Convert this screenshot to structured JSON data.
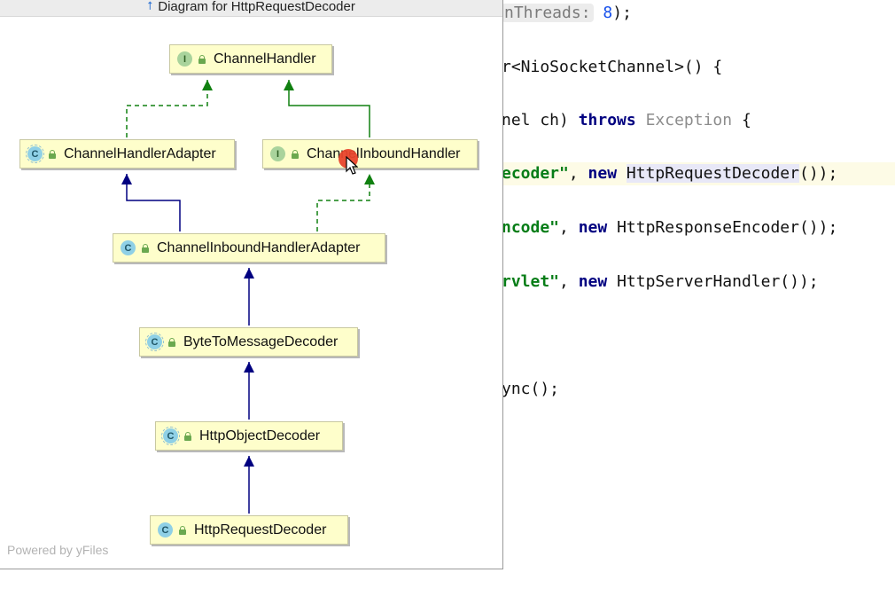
{
  "popup": {
    "title": "Diagram for HttpRequestDecoder",
    "powered_by": "Powered by yFiles"
  },
  "diagram": {
    "nodes": [
      {
        "id": "channel-handler",
        "kind": "I",
        "label": "ChannelHandler"
      },
      {
        "id": "channel-handler-adapter",
        "kind": "C",
        "label": "ChannelHandlerAdapter"
      },
      {
        "id": "channel-inbound-handler",
        "kind": "I",
        "label": "ChannelInboundHandler"
      },
      {
        "id": "channel-inbound-handler-adapter",
        "kind": "C",
        "label": "ChannelInboundHandlerAdapter"
      },
      {
        "id": "byte-to-message-decoder",
        "kind": "C",
        "label": "ByteToMessageDecoder"
      },
      {
        "id": "http-object-decoder",
        "kind": "C",
        "label": "HttpObjectDecoder"
      },
      {
        "id": "http-request-decoder",
        "kind": "C",
        "label": "HttpRequestDecoder"
      }
    ],
    "edges": [
      {
        "from": "channel-handler-adapter",
        "to": "channel-handler",
        "type": "implements"
      },
      {
        "from": "channel-inbound-handler",
        "to": "channel-handler",
        "type": "extends-interface"
      },
      {
        "from": "channel-inbound-handler-adapter",
        "to": "channel-handler-adapter",
        "type": "extends"
      },
      {
        "from": "channel-inbound-handler-adapter",
        "to": "channel-inbound-handler",
        "type": "implements"
      },
      {
        "from": "byte-to-message-decoder",
        "to": "channel-inbound-handler-adapter",
        "type": "extends"
      },
      {
        "from": "http-object-decoder",
        "to": "byte-to-message-decoder",
        "type": "extends"
      },
      {
        "from": "http-request-decoder",
        "to": "http-object-decoder",
        "type": "extends"
      }
    ]
  },
  "code": {
    "line1": {
      "hint": "nThreads:",
      "num": "8",
      "tail": ");"
    },
    "line2": {
      "text": "r<NioSocketChannel>() {"
    },
    "line3": {
      "a": "nel ch) ",
      "kw": "throws",
      "b": " ",
      "type": "Exception",
      "c": " {"
    },
    "line4": {
      "str": "ecoder\"",
      "a": ", ",
      "kw": "new",
      "b": " ",
      "cls": "HttpRequestDecoder",
      "c": "());"
    },
    "line5": {
      "str": "ncode\"",
      "a": ", ",
      "kw": "new",
      "b": " HttpResponseEncoder());"
    },
    "line6": {
      "str": "rvlet\"",
      "a": ", ",
      "kw": "new",
      "b": " HttpServerHandler());"
    },
    "line7": {
      "text": "ync();"
    }
  },
  "colors": {
    "node_fill": "#fefecb",
    "implements_edge": "#108010",
    "extends_edge": "#000080",
    "keyword": "#000080",
    "string": "#067d17"
  }
}
